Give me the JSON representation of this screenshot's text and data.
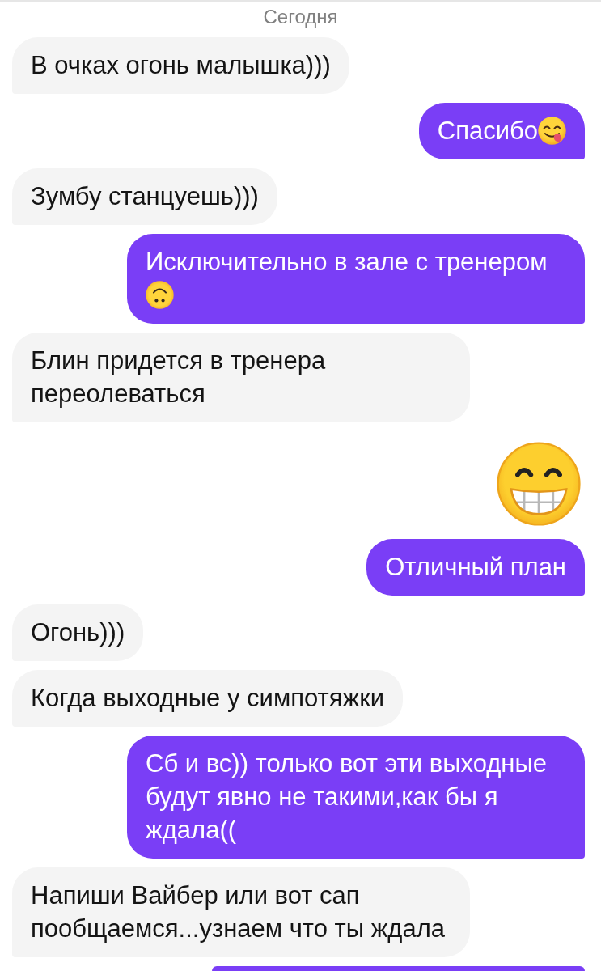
{
  "date_label": "Сегодня",
  "messages": [
    {
      "outgoing": false,
      "kind": "text",
      "text": "В очках огонь малышка)))"
    },
    {
      "outgoing": true,
      "kind": "text",
      "text": "Спасибо",
      "emoji": {
        "kind": "savoring"
      }
    },
    {
      "outgoing": false,
      "kind": "text",
      "text": "Зумбу станцуешь)))"
    },
    {
      "outgoing": true,
      "kind": "text",
      "text": "Исключительно в зале с тренером",
      "emoji": {
        "kind": "upside_down"
      }
    },
    {
      "outgoing": false,
      "kind": "text",
      "text": "Блин придется в тренера переолеваться"
    },
    {
      "outgoing": true,
      "kind": "sticker",
      "emoji": {
        "kind": "grinning"
      }
    },
    {
      "outgoing": true,
      "kind": "text",
      "text": "Отличный план"
    },
    {
      "outgoing": false,
      "kind": "text",
      "text": "Огонь)))"
    },
    {
      "outgoing": false,
      "kind": "text",
      "text": "Когда выходные у симпотяжки"
    },
    {
      "outgoing": true,
      "kind": "text",
      "text": "Сб и вс)) только вот эти выходные будут явно не такими,как бы я ждала(("
    },
    {
      "outgoing": false,
      "kind": "text",
      "text": "Напиши Вайбер или вот сап пообщаемся...узнаем что ты ждала"
    },
    {
      "outgoing": true,
      "kind": "cut_off"
    }
  ]
}
